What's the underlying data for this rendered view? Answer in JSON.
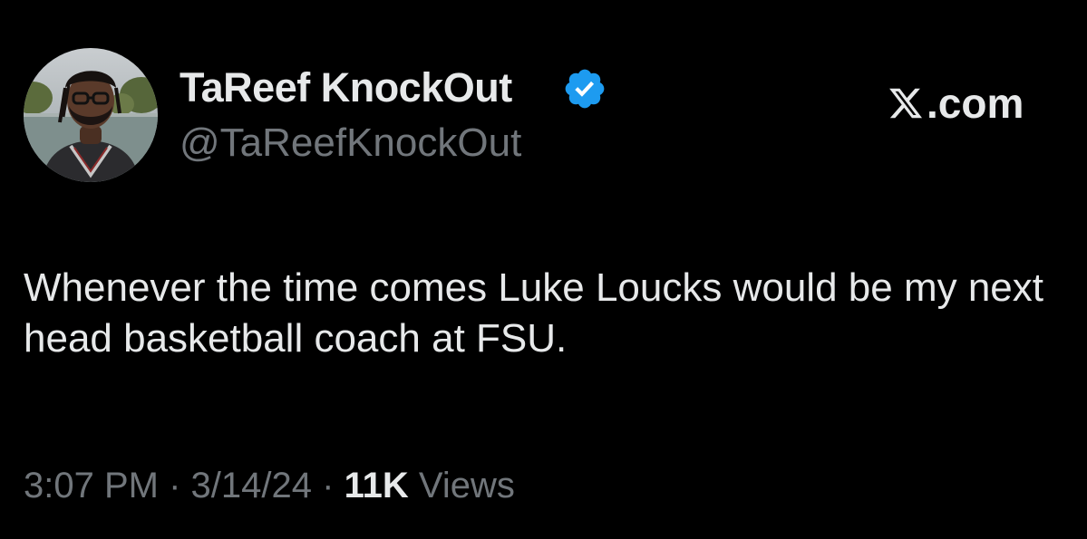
{
  "tweet": {
    "author": {
      "display_name": "TaReef KnockOut",
      "handle": "@TaReefKnockOut",
      "verified": true,
      "verified_color": "#1d9bf0",
      "avatar_icon": "profile-photo"
    },
    "brand": {
      "icon": "x-logo-icon",
      "text": ".com"
    },
    "text": "Whenever the time comes Luke Loucks would be my next head basketball coach at FSU.",
    "meta": {
      "time": "3:07 PM",
      "separator": "·",
      "date": "3/14/24",
      "views_count": "11K",
      "views_label": "Views"
    }
  },
  "colors": {
    "background": "#000000",
    "primary_text": "#e7e9ea",
    "secondary_text": "#71767b"
  }
}
